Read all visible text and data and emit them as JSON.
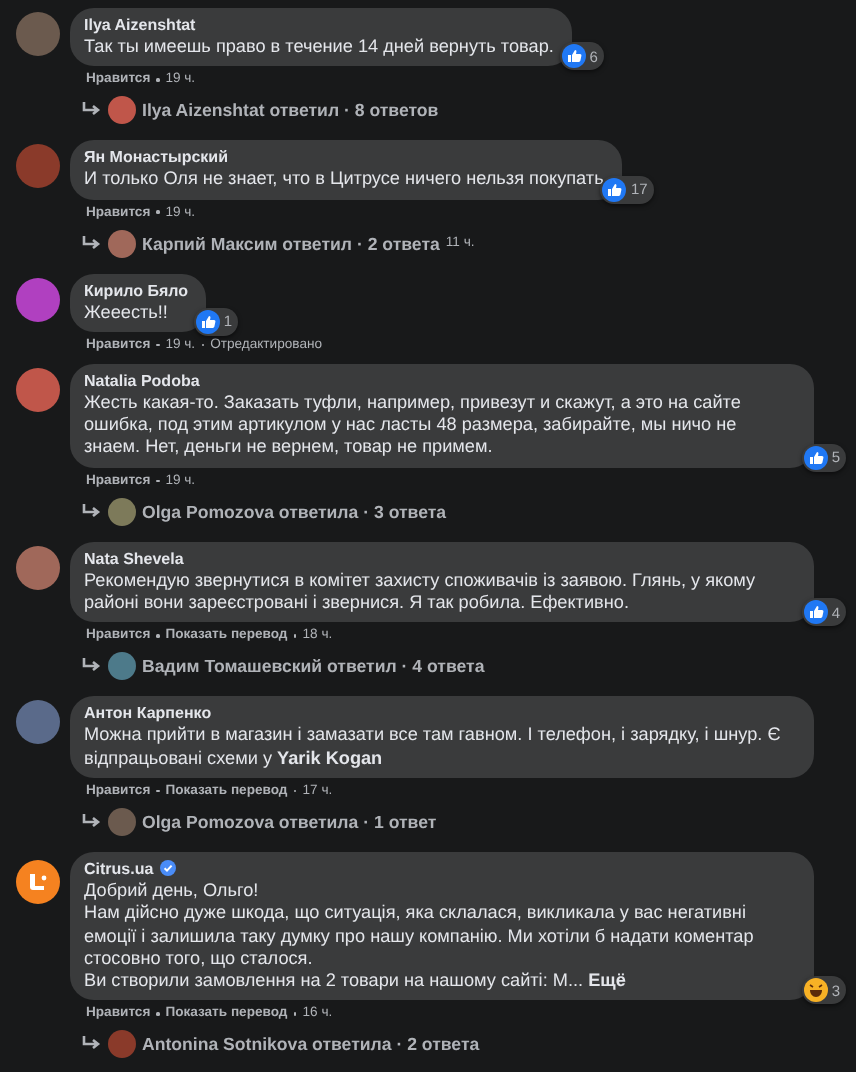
{
  "comments": [
    {
      "author": "Ilya Aizenshtat",
      "text": "Так ты имеешь право в течение 14 дней вернуть товар.",
      "reaction": {
        "kind": "like",
        "count": "6"
      },
      "actions": [
        "Нравится"
      ],
      "time": "19 ч.",
      "replies": {
        "text": "Ilya Aizenshtat ответил · 8 ответов"
      }
    },
    {
      "author": "Ян Монастырский",
      "text": "И только Оля не знает, что в Цитрусе ничего нельзя покупать",
      "reaction": {
        "kind": "like",
        "count": "17"
      },
      "actions": [
        "Нравится"
      ],
      "time": "19 ч.",
      "replies": {
        "text": "Карпий Максим ответил · 2 ответа",
        "time": "11 ч."
      }
    },
    {
      "author": "Кирило Бяло",
      "text": "Жееесть!!",
      "reaction": {
        "kind": "like",
        "count": "1"
      },
      "actions": [
        "Нравится"
      ],
      "time": "19 ч.",
      "edited": "Отредактировано"
    },
    {
      "author": "Natalia Podoba",
      "text": "Жесть какая-то. Заказать туфли, например, привезут и скажут, а это на сайте ошибка, под этим артикулом у нас ласты 48 размера, забирайте, мы ничо не знаем. Нет, деньги не вернем, товар не примем.",
      "reaction": {
        "kind": "like",
        "count": "5"
      },
      "actions": [
        "Нравится"
      ],
      "time": "19 ч.",
      "replies": {
        "text": "Olga Pomozova ответила · 3 ответа"
      }
    },
    {
      "author": "Nata Shevela",
      "text": "Рекомендую звернутися в комітет захисту споживачів із заявою. Глянь, у якому районі вони зареєстровані і звернися. Я так робила. Ефективно.",
      "reaction": {
        "kind": "like",
        "count": "4"
      },
      "actions": [
        "Нравится",
        "Показать перевод"
      ],
      "time": "18 ч.",
      "replies": {
        "text": "Вадим Томашевский ответил · 4 ответа"
      }
    },
    {
      "author": "Антон Карпенко",
      "text": "Можна прийти в магазин і замазати все там гавном. І телефон, і зарядку, і шнур. Є відпрацьовані схеми у **Yarik Kogan**",
      "actions": [
        "Нравится",
        "Показать перевод"
      ],
      "time": "17 ч.",
      "replies": {
        "text": "Olga Pomozova ответила · 1 ответ"
      }
    },
    {
      "author": "Citrus.ua",
      "verified": true,
      "page_logo": true,
      "text": "Добрий день, Ольго!\nНам дійсно дуже шкода, що ситуація, яка склалася, викликала у вас негативні емоції і залишила таку думку про нашу компанію. Ми хотіли б надати коментар стосовно того, що сталося.\nВи створили замовлення на 2 товари на нашому сайті: М... **Ещё**",
      "reaction": {
        "kind": "haha",
        "count": "3"
      },
      "actions": [
        "Нравится",
        "Показать перевод"
      ],
      "time": "16 ч.",
      "replies": {
        "text": "Antonina Sotnikova ответила · 2 ответа"
      }
    }
  ]
}
